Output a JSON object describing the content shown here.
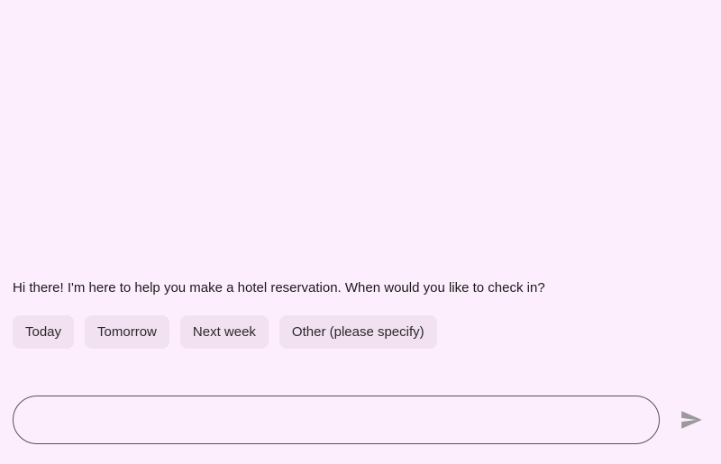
{
  "chat": {
    "bot_message": "Hi there! I'm here to help you make a hotel reservation. When would you like to check in?",
    "quick_replies": [
      {
        "label": "Today"
      },
      {
        "label": "Tomorrow"
      },
      {
        "label": "Next week"
      },
      {
        "label": "Other (please specify)"
      }
    ]
  },
  "input": {
    "value": "",
    "placeholder": ""
  }
}
